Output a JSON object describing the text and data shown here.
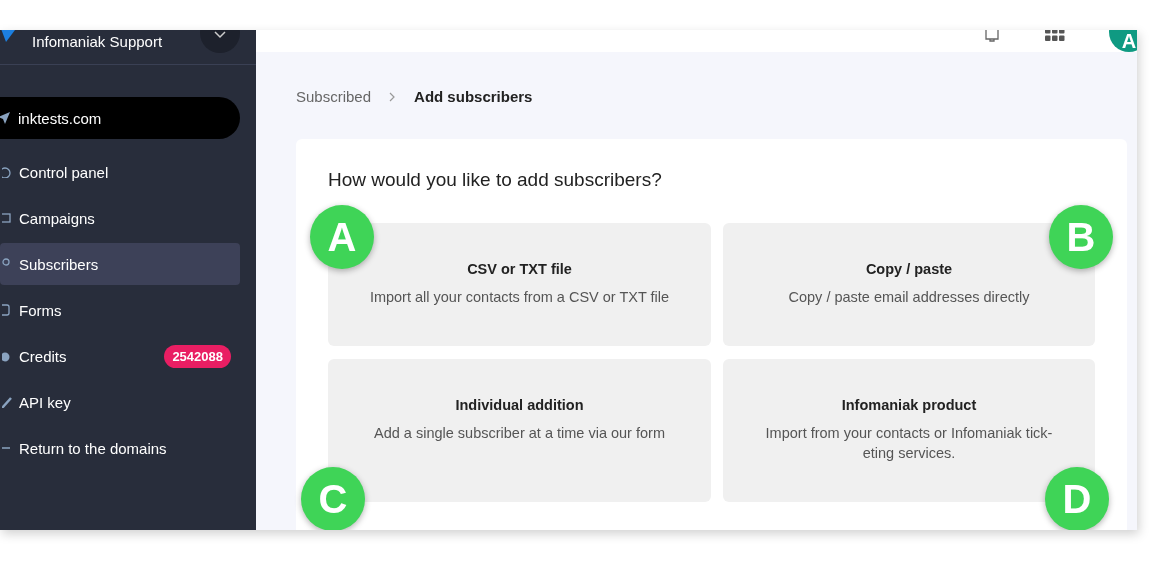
{
  "sidebar": {
    "org": "Infomaniak Support",
    "domain": "inktests.com",
    "items": [
      {
        "label": "Control panel",
        "selected": false
      },
      {
        "label": "Campaigns",
        "selected": false
      },
      {
        "label": "Subscribers",
        "selected": true
      },
      {
        "label": "Forms",
        "selected": false
      },
      {
        "label": "Credits",
        "selected": false,
        "badge": "2542088"
      },
      {
        "label": "API key",
        "selected": false
      },
      {
        "label": "Return to the domains",
        "selected": false
      }
    ]
  },
  "header": {
    "avatar": "A"
  },
  "breadcrumb": [
    "Subscribed",
    "Add subscribers"
  ],
  "panel": {
    "title": "How would you like to add subscribers?",
    "options": [
      {
        "title": "CSV or TXT file",
        "description": "Import all your contacts from a CSV or TXT file"
      },
      {
        "title": "Copy / paste",
        "description": "Copy / paste email addresses directly"
      },
      {
        "title": "Individual addition",
        "description": "Add a single subscriber at a time via our form"
      },
      {
        "title": "Infomaniak product",
        "description": "Import from your contacts or Infomaniak tick-eting services."
      }
    ],
    "callouts": [
      "A",
      "B",
      "C",
      "D"
    ]
  }
}
